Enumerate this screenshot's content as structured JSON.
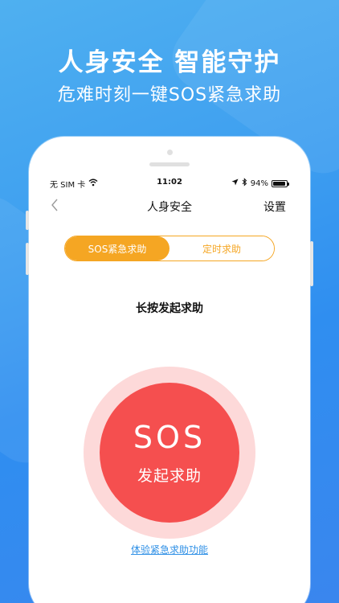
{
  "promo": {
    "headline": "人身安全 智能守护",
    "subline": "危难时刻一键SOS紧急求助"
  },
  "status_bar": {
    "carrier": "无 SIM 卡",
    "time": "11:02",
    "battery": "94%",
    "battery_level": 0.94
  },
  "nav": {
    "back_icon": "chevron-left-icon",
    "title": "人身安全",
    "settings": "设置"
  },
  "tabs": [
    {
      "label": "SOS紧急求助",
      "active": true
    },
    {
      "label": "定时求助",
      "active": false
    }
  ],
  "main": {
    "instruction": "长按发起求助",
    "sos_label": "SOS",
    "sos_sublabel": "发起求助",
    "experience_link": "体验紧急求助功能"
  },
  "colors": {
    "accent_orange": "#f5a623",
    "sos_red": "#f54f4f",
    "sos_halo": "#fdd9d9",
    "link_blue": "#2d8fe6",
    "background_blue": "#3e9ff0"
  }
}
